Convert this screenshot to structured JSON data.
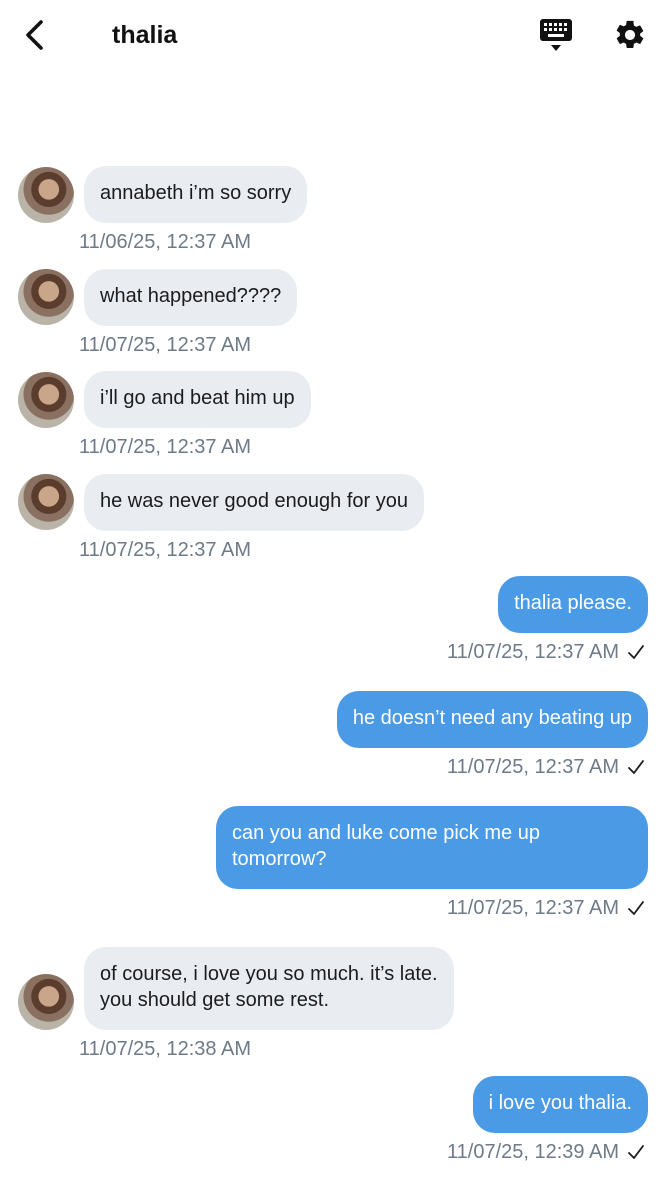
{
  "header": {
    "title": "thalia",
    "back_icon": "chevron-left-icon",
    "keyboard_icon": "keyboard-icon",
    "settings_icon": "gear-icon"
  },
  "colors": {
    "incoming_bubble": "#e9ecf0",
    "outgoing_bubble": "#4a9ae6",
    "timestamp": "#6e7a88"
  },
  "messages": [
    {
      "direction": "in",
      "text": "annabeth i’m so sorry",
      "time": "11/06/25, 12:37 AM"
    },
    {
      "direction": "in",
      "text": "what happened????",
      "time": "11/07/25, 12:37 AM"
    },
    {
      "direction": "in",
      "text": "i’ll go and beat him up",
      "time": "11/07/25, 12:37 AM"
    },
    {
      "direction": "in",
      "text": "he was never good enough for you",
      "time": "11/07/25, 12:37 AM"
    },
    {
      "direction": "out",
      "text": "thalia please.",
      "time": "11/07/25, 12:37 AM",
      "read": true
    },
    {
      "direction": "out",
      "text": "he doesn’t need any beating up",
      "time": "11/07/25, 12:37 AM",
      "read": true
    },
    {
      "direction": "out",
      "text": "can you and luke come pick me up\ntomorrow?",
      "time": "11/07/25, 12:37 AM",
      "read": true
    },
    {
      "direction": "in",
      "text": "of course, i love you so much. it’s late.\nyou should get some rest.",
      "time": "11/07/25, 12:38 AM"
    },
    {
      "direction": "out",
      "text": "i love you thalia.",
      "time": "11/07/25, 12:39 AM",
      "read": true
    }
  ]
}
